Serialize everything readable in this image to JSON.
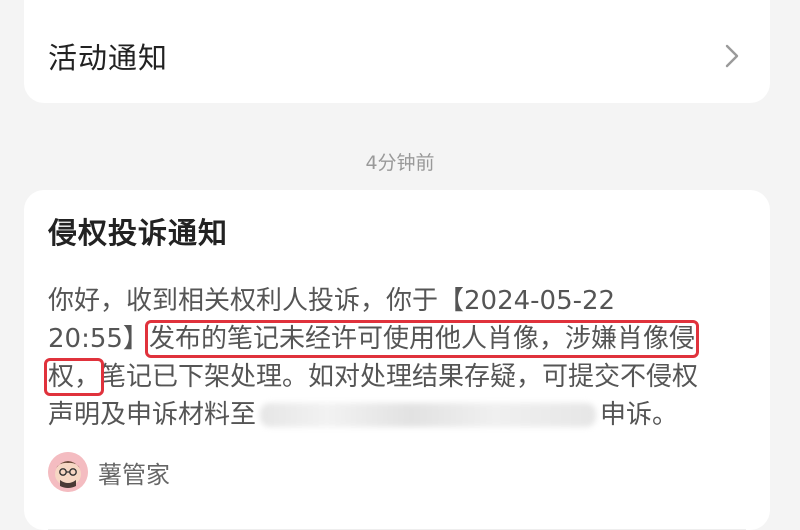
{
  "activity_card": {
    "title": "活动通知"
  },
  "timestamp": "4分钟前",
  "notice": {
    "title": "侵权投诉通知",
    "line1": "你好，收到相关权利人投诉，你于【2024-05-22",
    "line2_prefix": "20:55】",
    "line2_highlight": "发布的笔记未经许可使用他人肖像，涉嫌肖像侵",
    "line3_highlight": "权，",
    "line3_rest": "笔记已下架处理。如对处理结果存疑，可提交不侵权",
    "line4_prefix": "声明及申诉材料至",
    "line4_suffix": "申诉。"
  },
  "sender": {
    "name": "薯管家",
    "avatar_icon": "potato-butler-avatar"
  },
  "colors": {
    "highlight": "#e0323c",
    "background": "#f4f4f4"
  }
}
